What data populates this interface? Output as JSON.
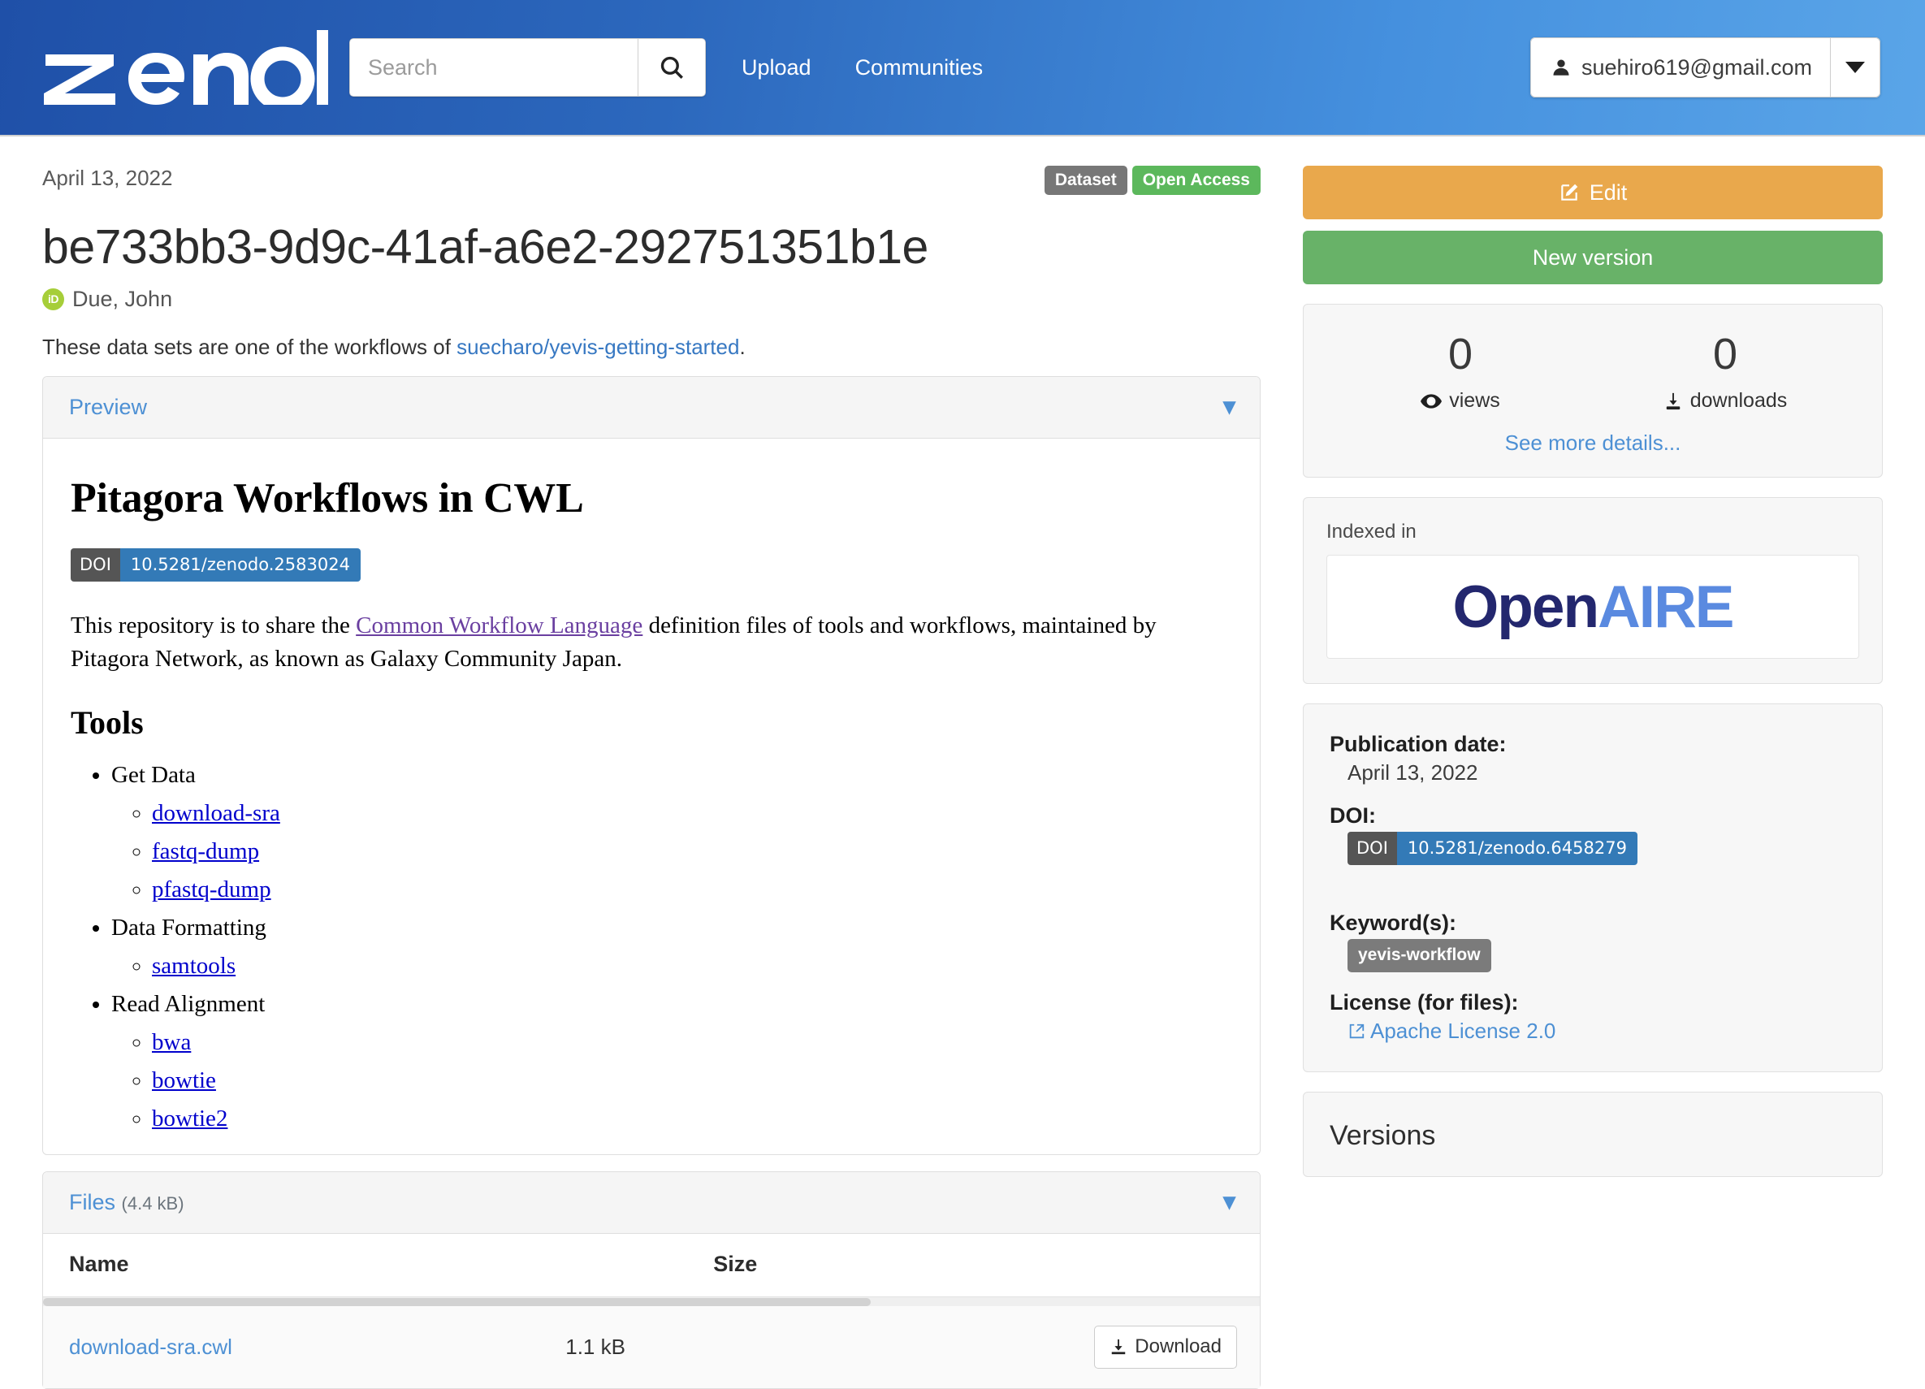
{
  "header": {
    "logo_text": "zenodo",
    "search": {
      "value": "",
      "placeholder": "Search",
      "icon": "search-icon"
    },
    "nav": [
      {
        "label": "Upload"
      },
      {
        "label": "Communities"
      }
    ],
    "user": {
      "email": "suehiro619@gmail.com",
      "icon": "user-icon",
      "caret": "caret-down-icon"
    },
    "gradient_from": "#1f50a8",
    "gradient_to": "#5aa5e8"
  },
  "record": {
    "publication_date_top": "April 13, 2022",
    "badges": [
      {
        "label": "Dataset",
        "color": "#777777"
      },
      {
        "label": "Open Access",
        "color": "#5cb85c"
      }
    ],
    "title": "be733bb3-9d9c-41af-a6e2-292751351b1e",
    "author": {
      "name": "Due, John",
      "orcid_icon_label": "iD",
      "orcid_color": "#a6ce39"
    },
    "description_prefix": "These data sets are one of the workflows of ",
    "description_link": "suecharo/yevis-getting-started",
    "description_suffix": "."
  },
  "preview": {
    "panel_label": "Preview",
    "chevron": "chevron-down-icon",
    "doc_title": "Pitagora Workflows in CWL",
    "doi": {
      "key": "DOI",
      "value": "10.5281/zenodo.2583024"
    },
    "paragraph_1a": "This repository is to share the ",
    "paragraph_link": "Common Workflow Language",
    "paragraph_1b": " definition files of tools and workflows, maintained by Pitagora Network, as known as Galaxy Community Japan.",
    "tools_heading": "Tools",
    "tool_groups": [
      {
        "label": "Get Data",
        "items": [
          "download-sra",
          "fastq-dump",
          "pfastq-dump"
        ]
      },
      {
        "label": "Data Formatting",
        "items": [
          "samtools"
        ]
      },
      {
        "label": "Read Alignment",
        "items": [
          "bwa",
          "bowtie",
          "bowtie2"
        ]
      }
    ]
  },
  "files": {
    "panel_label": "Files",
    "panel_size": "(4.4 kB)",
    "chevron": "chevron-down-icon",
    "columns": [
      "Name",
      "Size",
      ""
    ],
    "rows": [
      {
        "name": "download-sra.cwl",
        "size": "1.1 kB",
        "action": "Download",
        "action_icon": "download-icon"
      }
    ]
  },
  "sidebar": {
    "edit_button": {
      "label": "Edit",
      "icon": "edit-icon",
      "color": "#e9a84c"
    },
    "new_version_button": {
      "label": "New version",
      "color": "#68b268"
    },
    "stats": {
      "views": {
        "value": "0",
        "label": "views",
        "icon": "eye-icon"
      },
      "downloads": {
        "value": "0",
        "label": "downloads",
        "icon": "download-icon"
      },
      "see_more": "See more details..."
    },
    "indexed": {
      "label": "Indexed in",
      "logo_part1": "Open",
      "logo_part2": "AIRE",
      "logo_color1": "#23276e",
      "logo_color2": "#5a8ae0"
    },
    "metadata": {
      "pub_date_key": "Publication date:",
      "pub_date_value": "April 13, 2022",
      "doi_key": "DOI:",
      "doi_badge_key": "DOI",
      "doi_badge_value": "10.5281/zenodo.6458279",
      "keywords_key": "Keyword(s):",
      "keywords": [
        "yevis-workflow"
      ],
      "license_key": "License (for files):",
      "license_value": "Apache License 2.0",
      "license_icon": "external-link-icon"
    },
    "versions": {
      "title": "Versions"
    }
  }
}
